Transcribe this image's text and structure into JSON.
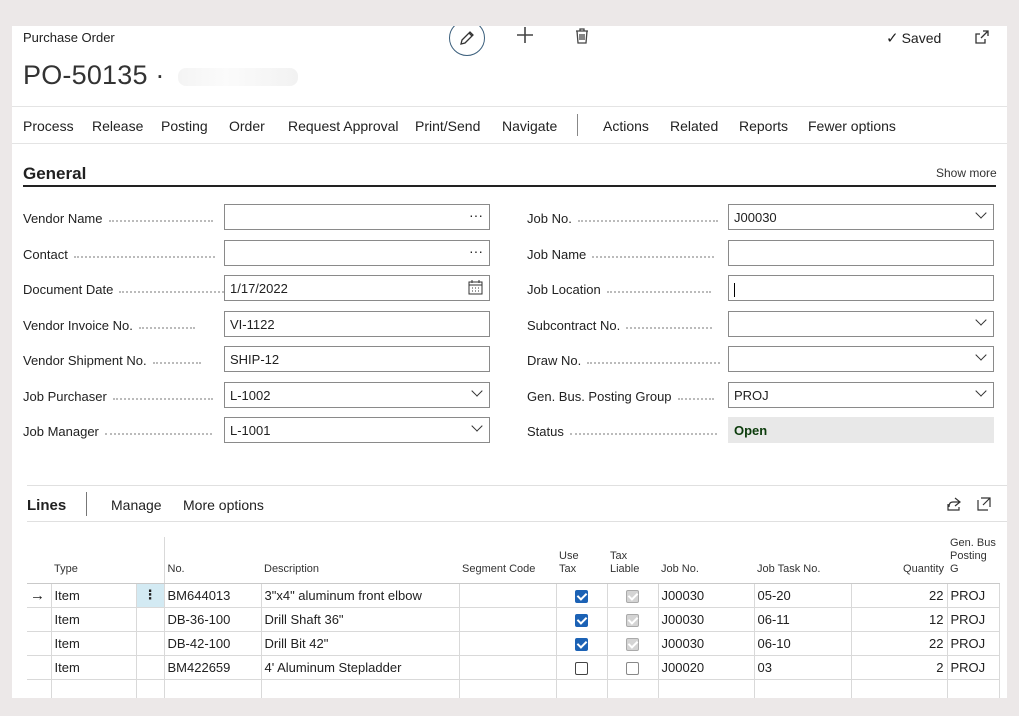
{
  "header": {
    "breadcrumb": "Purchase Order",
    "title": "PO-50135",
    "title_suffix": "·",
    "saved_label": "Saved",
    "saved_check": "✓"
  },
  "menu": [
    "Process",
    "Release",
    "Posting",
    "Order",
    "Request Approval",
    "Print/Send",
    "Navigate",
    "Actions",
    "Related",
    "Reports",
    "Fewer options"
  ],
  "general": {
    "heading": "General",
    "show_more": "Show more",
    "left_fields": [
      {
        "label": "Vendor Name",
        "value": "",
        "control": "lookup"
      },
      {
        "label": "Contact",
        "value": "",
        "control": "lookup"
      },
      {
        "label": "Document Date",
        "value": "1/17/2022",
        "control": "date"
      },
      {
        "label": "Vendor Invoice No.",
        "value": "VI-1122",
        "control": "text"
      },
      {
        "label": "Vendor Shipment No.",
        "value": "SHIP-12",
        "control": "text"
      },
      {
        "label": "Job Purchaser",
        "value": "L-1002",
        "control": "dropdown"
      },
      {
        "label": "Job Manager",
        "value": "L-1001",
        "control": "dropdown"
      }
    ],
    "right_fields": [
      {
        "label": "Job No.",
        "value": "J00030",
        "control": "dropdown"
      },
      {
        "label": "Job Name",
        "value": "",
        "control": "text"
      },
      {
        "label": "Job Location",
        "value": "",
        "control": "text"
      },
      {
        "label": "Subcontract No.",
        "value": "",
        "control": "dropdown"
      },
      {
        "label": "Draw No.",
        "value": "",
        "control": "dropdown"
      },
      {
        "label": "Gen. Bus. Posting Group",
        "value": "PROJ",
        "control": "dropdown"
      },
      {
        "label": "Status",
        "value": "Open",
        "control": "status"
      }
    ]
  },
  "lines": {
    "heading": "Lines",
    "manage": "Manage",
    "more_options": "More options",
    "columns": {
      "type": "Type",
      "no": "No.",
      "description": "Description",
      "segment_code": "Segment Code",
      "use_tax": "Use\nTax",
      "tax_liable": "Tax\nLiable",
      "job_no": "Job No.",
      "job_task_no": "Job Task No.",
      "quantity": "Quantity",
      "gen_bus": "Gen. Bus\nPosting G"
    },
    "row_arrow": "→",
    "row_menu": "⋮",
    "rows": [
      {
        "type": "Item",
        "no": "BM644013",
        "description": "3\"x4\" aluminum front elbow",
        "segment_code": "",
        "use_tax": true,
        "tax_liable": true,
        "job_no": "J00030",
        "job_task_no": "05-20",
        "quantity": "22",
        "gen_bus": "PROJ"
      },
      {
        "type": "Item",
        "no": "DB-36-100",
        "description": "Drill Shaft 36\"",
        "segment_code": "",
        "use_tax": true,
        "tax_liable": true,
        "job_no": "J00030",
        "job_task_no": "06-11",
        "quantity": "12",
        "gen_bus": "PROJ"
      },
      {
        "type": "Item",
        "no": "DB-42-100",
        "description": "Drill Bit 42\"",
        "segment_code": "",
        "use_tax": true,
        "tax_liable": true,
        "job_no": "J00030",
        "job_task_no": "06-10",
        "quantity": "22",
        "gen_bus": "PROJ"
      },
      {
        "type": "Item",
        "no": "BM422659",
        "description": "4' Aluminum Stepladder",
        "segment_code": "",
        "use_tax": false,
        "tax_liable": false,
        "job_no": "J00020",
        "job_task_no": "03",
        "quantity": "2",
        "gen_bus": "PROJ"
      }
    ]
  }
}
